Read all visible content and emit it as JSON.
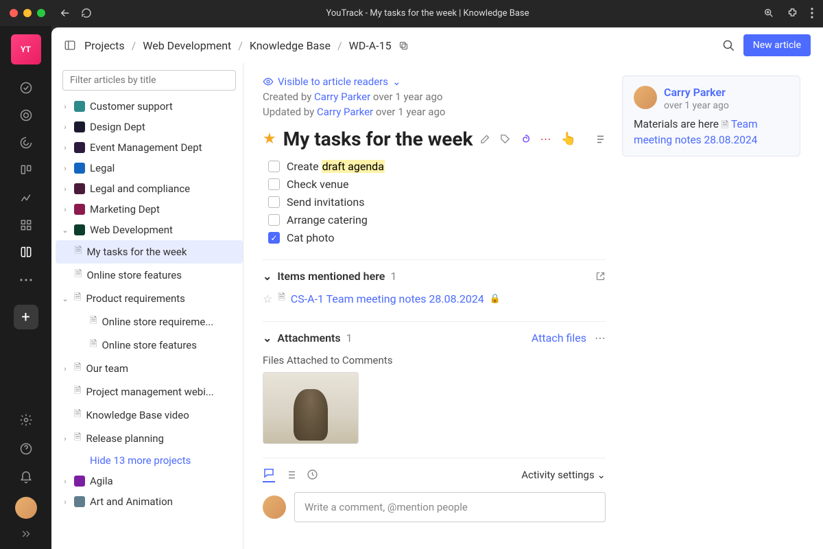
{
  "window": {
    "title": "YouTrack - My tasks for the week | Knowledge Base"
  },
  "breadcrumb": {
    "items": [
      "Projects",
      "Web Development",
      "Knowledge Base",
      "WD-A-15"
    ]
  },
  "header": {
    "new_article": "New article"
  },
  "filter": {
    "placeholder": "Filter articles by title"
  },
  "tree": {
    "projects": [
      {
        "label": "Customer support",
        "color": "#2e8b8b"
      },
      {
        "label": "Design Dept",
        "color": "#1a1a2e"
      },
      {
        "label": "Event Management Dept",
        "color": "#2d1b3d"
      },
      {
        "label": "Legal",
        "color": "#1565c0"
      },
      {
        "label": "Legal and compliance",
        "color": "#4a1a3a"
      },
      {
        "label": "Marketing Dept",
        "color": "#8b1a4d"
      }
    ],
    "webdev": {
      "label": "Web Development",
      "color": "#0d3d2e"
    },
    "webdev_children": [
      {
        "label": "My tasks for the week",
        "selected": true
      },
      {
        "label": "Online store features"
      }
    ],
    "prodreq": {
      "label": "Product requirements"
    },
    "prodreq_children": [
      {
        "label": "Online store requireme..."
      },
      {
        "label": "Online store features"
      }
    ],
    "more_items": [
      {
        "label": "Our team"
      },
      {
        "label": "Project management webi..."
      },
      {
        "label": "Knowledge Base video"
      },
      {
        "label": "Release planning"
      }
    ],
    "hide_link": "Hide 13 more projects",
    "extra": [
      {
        "label": "Agila",
        "color": "#7b1fa2"
      },
      {
        "label": "Art and Animation",
        "color": "#607d8b"
      }
    ]
  },
  "article": {
    "visibility": "Visible to article readers",
    "created_prefix": "Created by ",
    "created_author": "Carry Parker",
    "created_suffix": " over 1 year ago",
    "updated_prefix": "Updated by ",
    "updated_author": "Carry Parker",
    "updated_suffix": " over 1 year ago",
    "title": "My tasks for the week",
    "checklist": [
      {
        "text": "Create ",
        "highlight": "draft agenda",
        "checked": false
      },
      {
        "text": "Check venue",
        "checked": false
      },
      {
        "text": "Send invitations",
        "checked": false
      },
      {
        "text": "Arrange catering",
        "checked": false
      },
      {
        "text": "Cat photo",
        "checked": true
      }
    ],
    "mentions": {
      "header": "Items mentioned here",
      "count": "1",
      "item": "CS-A-1 Team meeting notes 28.08.2024"
    },
    "attachments": {
      "header": "Attachments",
      "count": "1",
      "attach_link": "Attach files",
      "files_label": "Files Attached to Comments"
    },
    "activity_settings": "Activity settings",
    "comment_placeholder": "Write a comment, @mention people"
  },
  "comment_card": {
    "author": "Carry Parker",
    "time": "over 1 year ago",
    "body_prefix": "Materials are here ",
    "link": "Team meeting notes 28.08.2024"
  }
}
